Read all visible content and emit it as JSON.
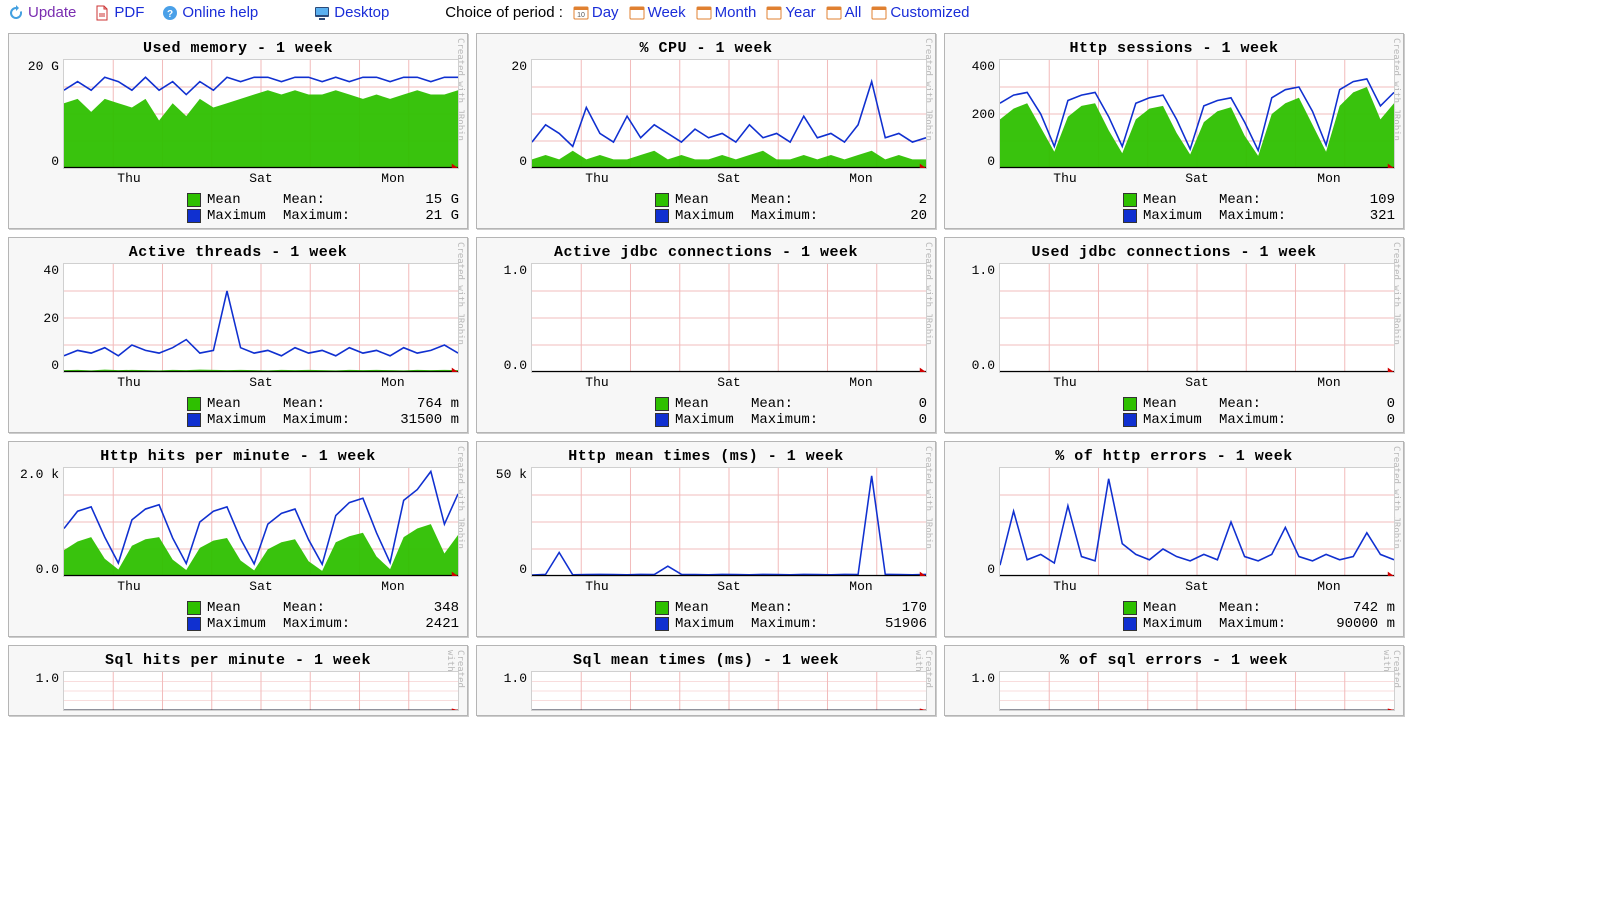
{
  "toolbar": {
    "update": "Update",
    "pdf": "PDF",
    "help": "Online help",
    "desktop": "Desktop",
    "period_label": "Choice of period :",
    "periods": [
      "Day",
      "Week",
      "Month",
      "Year",
      "All",
      "Customized"
    ]
  },
  "legend_labels": {
    "mean": "Mean",
    "max": "Maximum",
    "mean2": "Mean:",
    "max2": "Maximum:"
  },
  "watermark": "Created with JRobin",
  "xaxis_ticks": [
    "Thu",
    "Sat",
    "Mon"
  ],
  "chart_data": [
    {
      "title": "Used memory - 1 week",
      "yticks": [
        "20 G",
        "0"
      ],
      "ylim": 25,
      "mean": [
        15,
        16,
        13,
        16,
        15,
        14,
        16,
        11,
        15,
        12,
        16,
        14,
        15,
        16,
        17,
        18,
        17,
        18,
        17,
        17,
        18,
        17,
        16,
        17,
        16,
        17,
        18,
        17,
        17,
        18
      ],
      "max": [
        18,
        20,
        18,
        21,
        20,
        18,
        21,
        18,
        20,
        17,
        20,
        18,
        21,
        20,
        21,
        21,
        20,
        21,
        21,
        20,
        21,
        20,
        21,
        21,
        20,
        21,
        21,
        20,
        21,
        21
      ],
      "mean_val": "15 G",
      "max_val": "21 G"
    },
    {
      "title": "% CPU - 1 week",
      "yticks": [
        "20",
        "0"
      ],
      "ylim": 25,
      "mean": [
        2,
        3,
        2,
        4,
        2,
        3,
        2,
        2,
        3,
        4,
        2,
        3,
        2,
        2,
        3,
        2,
        3,
        4,
        2,
        2,
        3,
        2,
        3,
        2,
        3,
        4,
        2,
        3,
        2,
        2
      ],
      "max": [
        6,
        10,
        8,
        5,
        14,
        8,
        6,
        12,
        7,
        10,
        8,
        6,
        9,
        7,
        8,
        6,
        10,
        7,
        8,
        6,
        12,
        7,
        8,
        6,
        10,
        20,
        7,
        8,
        6,
        7
      ],
      "mean_val": "2",
      "max_val": "20"
    },
    {
      "title": "Http sessions - 1 week",
      "yticks": [
        "400",
        "200",
        "0"
      ],
      "ylim": 400,
      "mean": [
        180,
        220,
        240,
        150,
        60,
        190,
        230,
        240,
        140,
        55,
        180,
        220,
        230,
        130,
        50,
        170,
        210,
        225,
        120,
        45,
        200,
        240,
        260,
        160,
        60,
        230,
        280,
        300,
        180,
        240
      ],
      "max": [
        240,
        270,
        280,
        200,
        80,
        250,
        270,
        280,
        190,
        80,
        240,
        260,
        270,
        180,
        70,
        230,
        250,
        260,
        170,
        65,
        260,
        290,
        300,
        210,
        85,
        290,
        320,
        330,
        230,
        280
      ],
      "mean_val": "109",
      "max_val": "321"
    },
    {
      "title": "Active threads - 1 week",
      "yticks": [
        "40",
        "20",
        "0"
      ],
      "ylim": 40,
      "mean": [
        0.7,
        0.8,
        0.6,
        0.9,
        0.7,
        0.8,
        0.7,
        0.6,
        0.8,
        0.7,
        0.9,
        0.8,
        0.7,
        0.8,
        0.7,
        0.6,
        0.8,
        0.7,
        0.8,
        0.7,
        0.6,
        0.8,
        0.7,
        0.8,
        0.7,
        0.6,
        0.8,
        0.7,
        0.8,
        0.7
      ],
      "max": [
        6,
        8,
        7,
        9,
        6,
        10,
        8,
        7,
        9,
        12,
        7,
        8,
        30,
        9,
        7,
        8,
        6,
        9,
        7,
        8,
        6,
        9,
        7,
        8,
        6,
        9,
        7,
        8,
        10,
        7
      ],
      "mean_val": "764 m",
      "max_val": "31500 m"
    },
    {
      "title": "Active jdbc connections - 1 week",
      "yticks": [
        "1.0",
        "0.0"
      ],
      "ylim": 1,
      "mean": [
        0,
        0,
        0,
        0,
        0,
        0,
        0,
        0,
        0,
        0,
        0,
        0,
        0,
        0,
        0,
        0,
        0,
        0,
        0,
        0,
        0,
        0,
        0,
        0,
        0,
        0,
        0,
        0,
        0,
        0
      ],
      "max": [
        0,
        0,
        0,
        0,
        0,
        0,
        0,
        0,
        0,
        0,
        0,
        0,
        0,
        0,
        0,
        0,
        0,
        0,
        0,
        0,
        0,
        0,
        0,
        0,
        0,
        0,
        0,
        0,
        0,
        0
      ],
      "mean_val": "0",
      "max_val": "0"
    },
    {
      "title": "Used jdbc connections - 1 week",
      "yticks": [
        "1.0",
        "0.0"
      ],
      "ylim": 1,
      "mean": [
        0,
        0,
        0,
        0,
        0,
        0,
        0,
        0,
        0,
        0,
        0,
        0,
        0,
        0,
        0,
        0,
        0,
        0,
        0,
        0,
        0,
        0,
        0,
        0,
        0,
        0,
        0,
        0,
        0,
        0
      ],
      "max": [
        0,
        0,
        0,
        0,
        0,
        0,
        0,
        0,
        0,
        0,
        0,
        0,
        0,
        0,
        0,
        0,
        0,
        0,
        0,
        0,
        0,
        0,
        0,
        0,
        0,
        0,
        0,
        0,
        0,
        0
      ],
      "mean_val": "0",
      "max_val": "0"
    },
    {
      "title": "Http hits per minute - 1 week",
      "yticks": [
        "2.0 k",
        "0.0"
      ],
      "ylim": 2500,
      "mean": [
        600,
        800,
        900,
        400,
        150,
        700,
        850,
        900,
        380,
        140,
        650,
        820,
        880,
        360,
        130,
        620,
        780,
        850,
        340,
        120,
        780,
        920,
        1000,
        450,
        160,
        900,
        1100,
        1200,
        520,
        950
      ],
      "max": [
        1100,
        1500,
        1600,
        900,
        300,
        1300,
        1550,
        1650,
        880,
        290,
        1250,
        1500,
        1600,
        860,
        280,
        1200,
        1450,
        1550,
        840,
        270,
        1400,
        1700,
        1800,
        1000,
        310,
        1750,
        2000,
        2420,
        1200,
        1900
      ],
      "mean_val": "348",
      "max_val": "2421"
    },
    {
      "title": "Http mean times (ms) - 1 week",
      "yticks": [
        "50 k",
        "0"
      ],
      "ylim": 55000,
      "mean": [
        150,
        200,
        180,
        160,
        170,
        180,
        170,
        160,
        180,
        170,
        160,
        180,
        170,
        160,
        180,
        170,
        160,
        180,
        170,
        160,
        180,
        170,
        160,
        180,
        170,
        160,
        180,
        170,
        160,
        180
      ],
      "max": [
        500,
        800,
        12000,
        600,
        700,
        800,
        700,
        600,
        800,
        700,
        5000,
        800,
        700,
        600,
        800,
        700,
        600,
        800,
        700,
        600,
        800,
        700,
        600,
        800,
        700,
        51000,
        800,
        700,
        600,
        800
      ],
      "mean_val": "170",
      "max_val": "51906"
    },
    {
      "title": "% of http errors - 1 week",
      "yticks": [
        "",
        "0"
      ],
      "ylim": 100,
      "mean": [
        0.5,
        0.8,
        0.6,
        0.9,
        0.7,
        0.8,
        0.7,
        0.6,
        0.8,
        0.7,
        0.9,
        0.8,
        0.7,
        0.8,
        0.7,
        0.6,
        0.8,
        0.7,
        0.8,
        0.7,
        0.6,
        0.8,
        0.7,
        0.8,
        0.7,
        0.6,
        0.8,
        0.7,
        0.8,
        0.7
      ],
      "max": [
        10,
        60,
        15,
        20,
        12,
        65,
        18,
        14,
        90,
        30,
        20,
        15,
        25,
        18,
        14,
        20,
        15,
        50,
        18,
        14,
        20,
        45,
        18,
        14,
        20,
        15,
        18,
        40,
        20,
        15
      ],
      "mean_val": "742 m",
      "max_val": "90000 m"
    },
    {
      "title": "Sql hits per minute - 1 week",
      "yticks": [
        "1.0",
        ""
      ],
      "ylim": 1,
      "partial": true,
      "mean": [
        0,
        0,
        0,
        0,
        0,
        0,
        0,
        0,
        0,
        0,
        0,
        0,
        0,
        0,
        0,
        0,
        0,
        0,
        0,
        0,
        0,
        0,
        0,
        0,
        0,
        0,
        0,
        0,
        0,
        0
      ],
      "max": [
        0,
        0,
        0,
        0,
        0,
        0,
        0,
        0,
        0,
        0,
        0,
        0,
        0,
        0,
        0,
        0,
        0,
        0,
        0,
        0,
        0,
        0,
        0,
        0,
        0,
        0,
        0,
        0,
        0,
        0
      ],
      "mean_val": "",
      "max_val": ""
    },
    {
      "title": "Sql mean times (ms) - 1 week",
      "yticks": [
        "1.0",
        ""
      ],
      "ylim": 1,
      "partial": true,
      "mean": [
        0,
        0,
        0,
        0,
        0,
        0,
        0,
        0,
        0,
        0,
        0,
        0,
        0,
        0,
        0,
        0,
        0,
        0,
        0,
        0,
        0,
        0,
        0,
        0,
        0,
        0,
        0,
        0,
        0,
        0
      ],
      "max": [
        0,
        0,
        0,
        0,
        0,
        0,
        0,
        0,
        0,
        0,
        0,
        0,
        0,
        0,
        0,
        0,
        0,
        0,
        0,
        0,
        0,
        0,
        0,
        0,
        0,
        0,
        0,
        0,
        0,
        0
      ],
      "mean_val": "",
      "max_val": ""
    },
    {
      "title": "% of sql errors - 1 week",
      "yticks": [
        "1.0",
        ""
      ],
      "ylim": 1,
      "partial": true,
      "mean": [
        0,
        0,
        0,
        0,
        0,
        0,
        0,
        0,
        0,
        0,
        0,
        0,
        0,
        0,
        0,
        0,
        0,
        0,
        0,
        0,
        0,
        0,
        0,
        0,
        0,
        0,
        0,
        0,
        0,
        0
      ],
      "max": [
        0,
        0,
        0,
        0,
        0,
        0,
        0,
        0,
        0,
        0,
        0,
        0,
        0,
        0,
        0,
        0,
        0,
        0,
        0,
        0,
        0,
        0,
        0,
        0,
        0,
        0,
        0,
        0,
        0,
        0
      ],
      "mean_val": "",
      "max_val": ""
    }
  ]
}
